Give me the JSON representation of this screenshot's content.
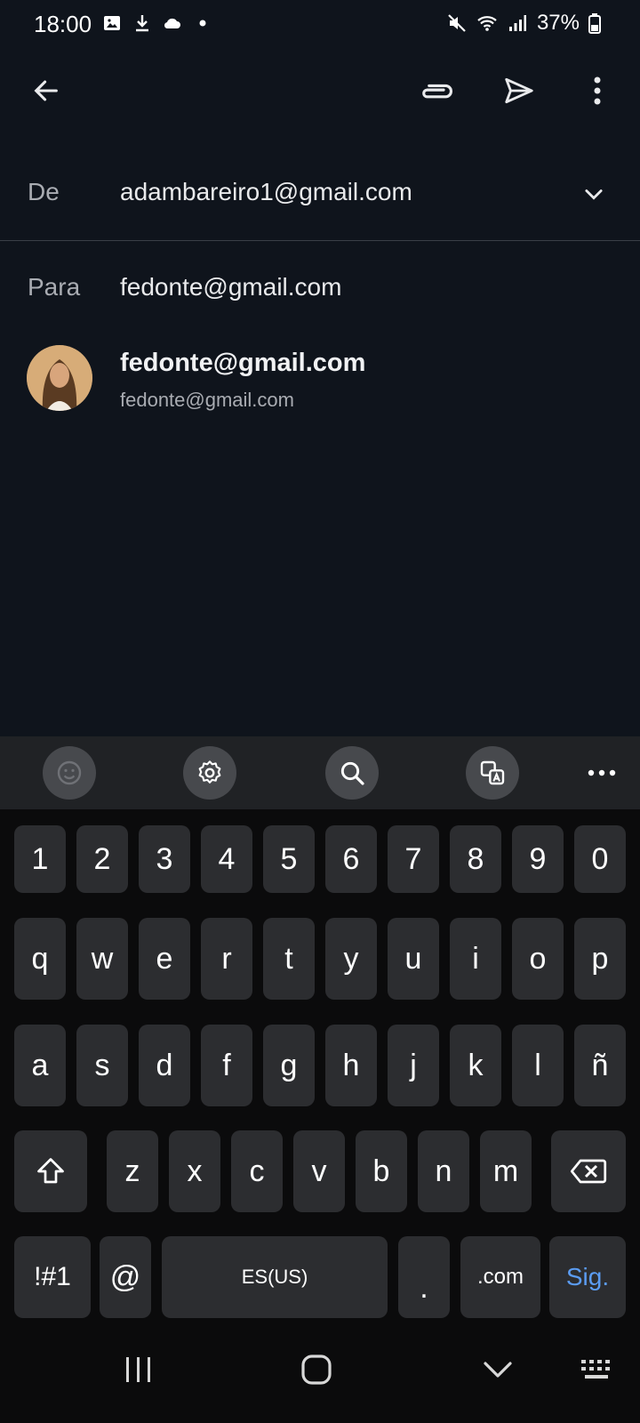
{
  "status_bar": {
    "time": "18:00",
    "battery": "37%",
    "icons": [
      "image-icon",
      "download-icon",
      "cloud-icon",
      "dot-icon",
      "mute-icon",
      "wifi-icon",
      "signal-icon",
      "battery-icon"
    ]
  },
  "appbar": {
    "icons": [
      "back-arrow-icon",
      "attach-icon",
      "send-icon",
      "more-vert-icon"
    ]
  },
  "compose": {
    "from_label": "De",
    "from_value": "adambareiro1@gmail.com",
    "to_label": "Para",
    "to_value": "fedonte@gmail.com"
  },
  "suggestion": {
    "name": "fedonte@gmail.com",
    "email": "fedonte@gmail.com"
  },
  "keyboard_toolbar": {
    "icons": [
      "emoji-icon",
      "settings-icon",
      "search-icon",
      "translate-icon",
      "more-horiz-icon"
    ]
  },
  "keyboard": {
    "row_numbers": [
      "1",
      "2",
      "3",
      "4",
      "5",
      "6",
      "7",
      "8",
      "9",
      "0"
    ],
    "row_1": [
      "q",
      "w",
      "e",
      "r",
      "t",
      "y",
      "u",
      "i",
      "o",
      "p"
    ],
    "row_2": [
      "a",
      "s",
      "d",
      "f",
      "g",
      "h",
      "j",
      "k",
      "l",
      "ñ"
    ],
    "row_3": [
      "z",
      "x",
      "c",
      "v",
      "b",
      "n",
      "m"
    ],
    "symbols_label": "!#1",
    "at_label": "@",
    "space_label": "ES(US)",
    "period_label": ".",
    "dotcom_label": ".com",
    "next_label": "Sig.",
    "next_color": "#5b9cf2"
  },
  "nav_bar": {
    "icons": [
      "recents-icon",
      "home-icon",
      "back-down-icon",
      "keyboard-switch-icon"
    ]
  }
}
